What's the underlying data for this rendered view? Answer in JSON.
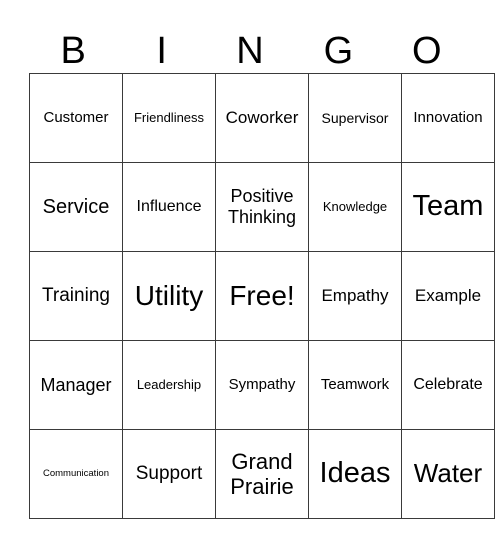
{
  "card": {
    "header": [
      "B",
      "I",
      "N",
      "G",
      "O"
    ],
    "rows": [
      [
        "Customer",
        "Friendliness",
        "Coworker",
        "Supervisor",
        "Innovation"
      ],
      [
        "Service",
        "Influence",
        "Positive Thinking",
        "Knowledge",
        "Team"
      ],
      [
        "Training",
        "Utility",
        "Free!",
        "Empathy",
        "Example"
      ],
      [
        "Manager",
        "Leadership",
        "Sympathy",
        "Teamwork",
        "Celebrate"
      ],
      [
        "Communication",
        "Support",
        "Grand Prairie",
        "Ideas",
        "Water"
      ]
    ]
  }
}
